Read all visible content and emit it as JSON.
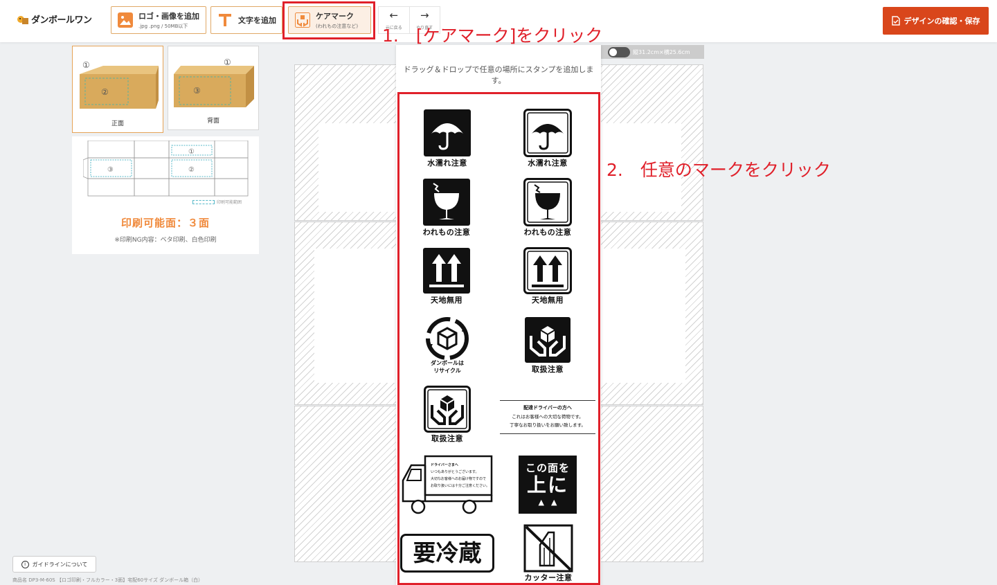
{
  "header": {
    "logo_text": "ダンボールワン",
    "add_logo": {
      "label": "ロゴ・画像を追加",
      "sub": ".jpg .png / 50MB以下"
    },
    "add_text": {
      "label": "文字を追加"
    },
    "care_mark": {
      "label": "ケアマーク",
      "sub": "(われもの注意など)"
    },
    "undo_label": "元に戻る",
    "redo_label": "やり直す",
    "save_label": "デザインの確認・保存"
  },
  "faces": [
    {
      "label": "正面",
      "active": true
    },
    {
      "label": "背面",
      "active": false
    }
  ],
  "info": {
    "print_area_label": "印刷可能範囲",
    "print_faces": "印刷可能面：３面",
    "print_ng": "※印刷NG内容：ベタ印刷、白色印刷"
  },
  "canvas": {
    "dimensions": "縦31.2cm×横25.6cm"
  },
  "stamp_panel": {
    "description": "ドラッグ＆ドロップで任意の場所にスタンプを追加します。",
    "stamps": [
      {
        "caption": "水濡れ注意",
        "icon": "umbrella-icon"
      },
      {
        "caption": "水濡れ注意",
        "icon": "umbrella-icon"
      },
      {
        "caption": "われもの注意",
        "icon": "fragile-glass-icon"
      },
      {
        "caption": "われもの注意",
        "icon": "fragile-glass-icon"
      },
      {
        "caption": "天地無用",
        "icon": "this-way-up-icon"
      },
      {
        "caption": "天地無用",
        "icon": "this-way-up-icon"
      },
      {
        "caption_line1": "ダンボールは",
        "caption_line2": "リサイクル",
        "icon": "recycle-icon"
      },
      {
        "caption": "取扱注意",
        "icon": "handle-with-care-icon"
      },
      {
        "caption": "取扱注意",
        "icon": "handle-with-care-icon"
      }
    ],
    "driver_note": {
      "title": "配達ドライバーの方へ",
      "line1": "これはお客様への大切な荷物です。",
      "line2": "丁寧なお取り扱いをお願い致します。"
    },
    "truck_note": {
      "title": "ドライバーさまへ",
      "line1": "いつもありがとうございます。",
      "line2": "大切なお客様へのお届け物ですので",
      "line3": "お取り扱いには十分ご注意ください。"
    },
    "this_side_up": {
      "line1": "この面を",
      "line2": "上に",
      "arrows": "▲▲"
    },
    "refrigerate": "要冷蔵",
    "cutter_caution": "カッター注意"
  },
  "annotations": {
    "step1": "1.　[ケアマーク]をクリック",
    "step2": "2.　任意のマークをクリック"
  },
  "footer": {
    "guide_button": "ガイドラインについて",
    "product_name": "商品名 DP3-M-60S 【ロゴ印刷・フルカラー・3面】宅配60サイズ ダンボール箱（白）"
  },
  "colors": {
    "accent": "#d9461b",
    "highlight": "#e0202a",
    "print_faces": "#f08a3c"
  }
}
